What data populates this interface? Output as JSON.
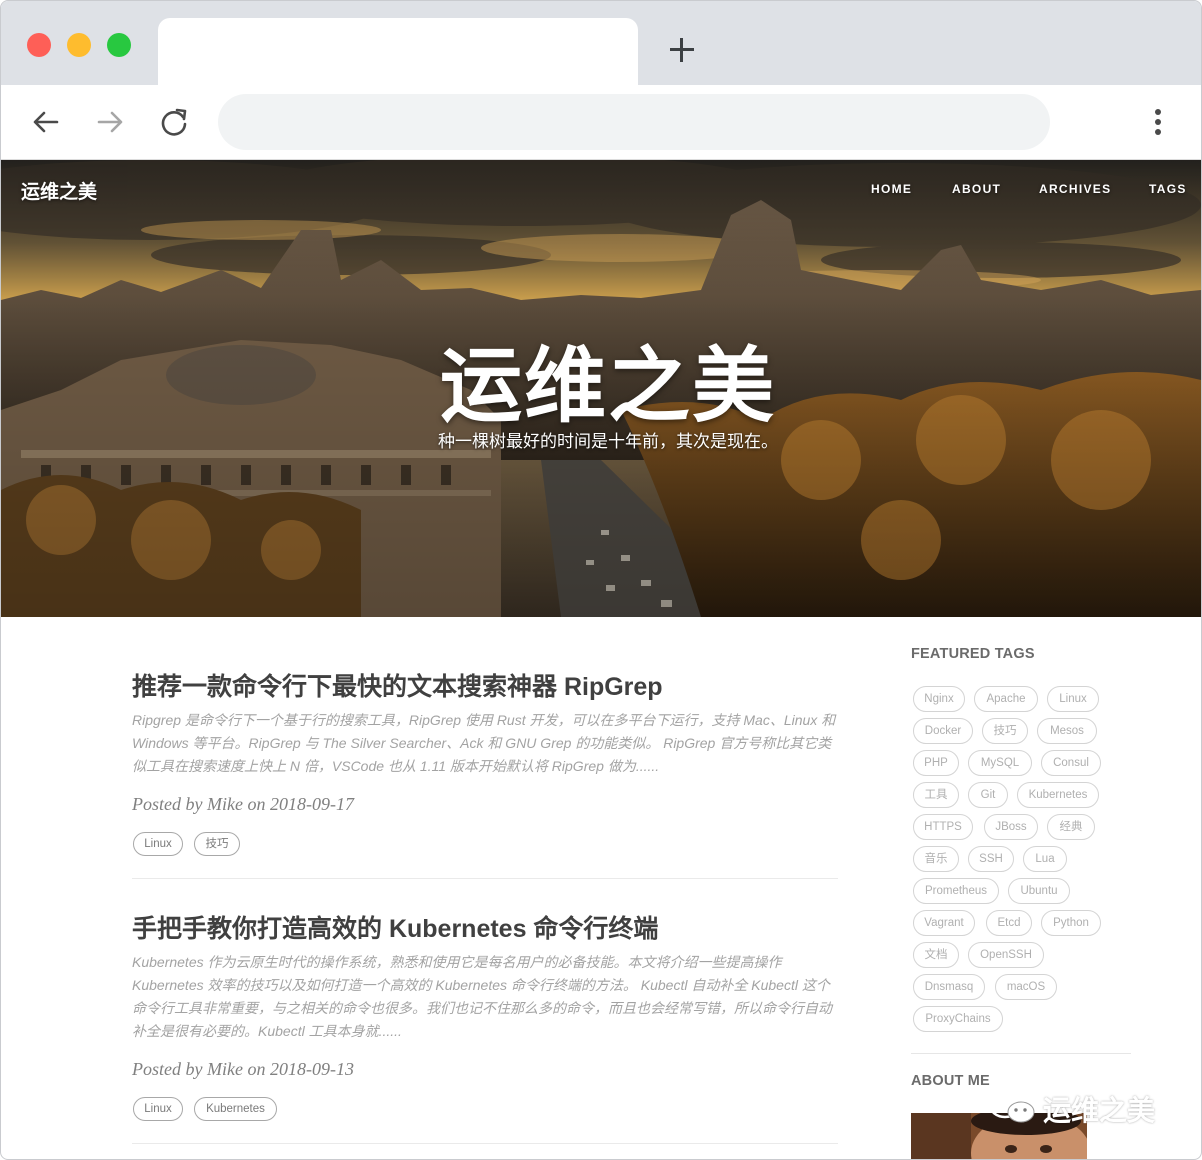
{
  "browser": {
    "new_tab_symbol": "+",
    "address_value": ""
  },
  "site": {
    "brand": "运维之美",
    "nav": [
      "HOME",
      "ABOUT",
      "ARCHIVES",
      "TAGS"
    ],
    "hero_title": "运维之美",
    "hero_subtitle": "种一棵树最好的时间是十年前，其次是现在。"
  },
  "posts": [
    {
      "title": "推荐一款命令行下最快的文本搜索神器 RipGrep",
      "excerpt": [
        "Ripgrep 是命令行下一个基于行的搜索工具，RipGrep 使用 Rust 开发，可以在多平台下运行，支持 Mac、Linux 和",
        "Windows 等平台。RipGrep 与 The Silver Searcher、Ack 和 GNU Grep 的功能类似。 RipGrep 官方号称比其它类",
        "似工具在搜索速度上快上 N 倍，VSCode 也从 1.11 版本开始默认将 RipGrep 做为......"
      ],
      "meta": "Posted by Mike on 2018-09-17",
      "tags": [
        "Linux",
        "技巧"
      ]
    },
    {
      "title": "手把手教你打造高效的 Kubernetes 命令行终端",
      "excerpt": [
        "Kubernetes 作为云原生时代的操作系统，熟悉和使用它是每名用户的必备技能。本文将介绍一些提高操作",
        "Kubernetes 效率的技巧以及如何打造一个高效的 Kubernetes 命令行终端的方法。 Kubectl 自动补全 Kubectl 这个",
        "命令行工具非常重要，与之相关的命令也很多。我们也记不住那么多的命令，而且也会经常写错，所以命令行自动",
        "补全是很有必要的。Kubectl 工具本身就......"
      ],
      "meta": "Posted by Mike on 2018-09-13",
      "tags": [
        "Linux",
        "Kubernetes"
      ]
    }
  ],
  "sidebar": {
    "featured_tags_heading": "FEATURED TAGS",
    "featured_tags": [
      "Nginx",
      "Apache",
      "Linux",
      "Docker",
      "技巧",
      "Mesos",
      "PHP",
      "MySQL",
      "Consul",
      "工具",
      "Git",
      "Kubernetes",
      "HTTPS",
      "JBoss",
      "经典",
      "音乐",
      "SSH",
      "Lua",
      "Prometheus",
      "Ubuntu",
      "Vagrant",
      "Etcd",
      "Python",
      "文档",
      "OpenSSH",
      "Dnsmasq",
      "macOS",
      "ProxyChains"
    ],
    "about_heading": "ABOUT ME"
  },
  "watermark": {
    "text": "运维之美"
  }
}
